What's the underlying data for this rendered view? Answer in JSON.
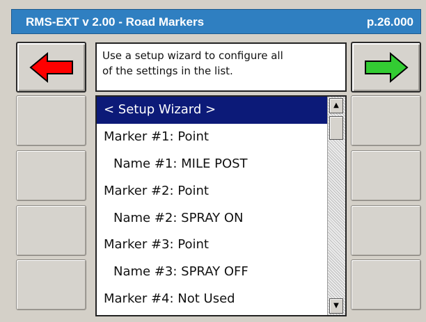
{
  "title_bar": {
    "title": "RMS-EXT v 2.00 - Road Markers",
    "page": "p.26.000"
  },
  "nav": {
    "back_icon": "left-arrow-icon",
    "back_color": "#ff0000",
    "forward_icon": "right-arrow-icon",
    "forward_color": "#33cc33"
  },
  "description": {
    "line1": "Use a setup wizard to configure all",
    "line2": "of the settings in the list."
  },
  "list": {
    "items": [
      "< Setup Wizard >",
      "Marker #1: Point",
      "Name #1: MILE POST",
      "Marker #2: Point",
      "Name #2: SPRAY ON",
      "Marker #3: Point",
      "Name #3: SPRAY OFF",
      "Marker #4: Not Used"
    ],
    "selected_index": 0
  },
  "colors": {
    "title_bar": "#2f7fc1",
    "selection": "#0c1a78",
    "panel": "#d4d0c8"
  }
}
